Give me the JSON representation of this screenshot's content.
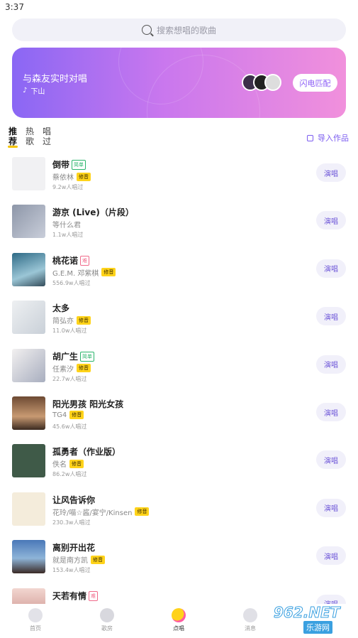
{
  "status_bar": {
    "time": "3:37"
  },
  "search": {
    "placeholder": "搜索想唱的歌曲"
  },
  "banner": {
    "title": "与森友实时对唱",
    "subtitle": "下山",
    "match_button": "闪电匹配"
  },
  "tabs": [
    {
      "label": "推荐",
      "active": true
    },
    {
      "label": "热歌",
      "active": false
    },
    {
      "label": "唱过",
      "active": false
    }
  ],
  "import_label": "导入作品",
  "songs": [
    {
      "title": "倒带",
      "tag": "简单",
      "tag_type": "easy",
      "artist": "蔡依林",
      "tuned": "修音",
      "plays": "9.2w人唱过",
      "button": "演唱",
      "cover": "placeholder"
    },
    {
      "title": "游京 (Live)（片段）",
      "tag": "",
      "tag_type": "",
      "artist": "等什么君",
      "tuned": "",
      "plays": "1.1w人唱过",
      "button": "演唱",
      "cover": "grey"
    },
    {
      "title": "桃花诺",
      "tag": "难",
      "tag_type": "hard",
      "artist": "G.E.M. 邓紫棋",
      "tuned": "修音",
      "plays": "556.9w人唱过",
      "button": "演唱",
      "cover": "teal"
    },
    {
      "title": "太多",
      "tag": "",
      "tag_type": "",
      "artist": "简弘亦",
      "tuned": "修音",
      "plays": "11.0w人唱过",
      "button": "演唱",
      "cover": "light"
    },
    {
      "title": "胡广生",
      "tag": "简单",
      "tag_type": "easy",
      "artist": "任素汐",
      "tuned": "修音",
      "plays": "22.7w人唱过",
      "button": "演唱",
      "cover": "light2"
    },
    {
      "title": "阳光男孩 阳光女孩",
      "tag": "",
      "tag_type": "",
      "artist": "TG4",
      "tuned": "修音",
      "plays": "45.6w人唱过",
      "button": "演唱",
      "cover": "warm"
    },
    {
      "title": "孤勇者（作业版）",
      "tag": "",
      "tag_type": "",
      "artist": "佚名",
      "tuned": "修音",
      "plays": "86.2w人唱过",
      "button": "演唱",
      "cover": "green"
    },
    {
      "title": "让风告诉你",
      "tag": "",
      "tag_type": "",
      "artist": "花玲/喵☆酱/宴宁/Kinsen",
      "tuned": "修音",
      "plays": "230.3w人唱过",
      "button": "演唱",
      "cover": "cream"
    },
    {
      "title": "离别开出花",
      "tag": "",
      "tag_type": "",
      "artist": "就是南方凯",
      "tuned": "修音",
      "plays": "153.4w人唱过",
      "button": "演唱",
      "cover": "sky"
    },
    {
      "title": "天若有情",
      "tag": "难",
      "tag_type": "hard",
      "artist": "",
      "tuned": "",
      "plays": "",
      "button": "演唱",
      "cover": "portrait"
    }
  ],
  "bottom_nav": [
    {
      "label": "首页",
      "icon": "home-icon",
      "active": false
    },
    {
      "label": "歌房",
      "icon": "room-icon",
      "active": false
    },
    {
      "label": "点唱",
      "icon": "sing-icon",
      "active": true
    },
    {
      "label": "消息",
      "icon": "message-icon",
      "active": false
    }
  ],
  "watermark": {
    "brand": "962.NET",
    "sub": "乐游网"
  },
  "colors": {
    "accent": "#7b5cf0",
    "tuned_badge": "#ffd31a",
    "banner_start": "#8a67f4",
    "banner_end": "#f190dc"
  }
}
